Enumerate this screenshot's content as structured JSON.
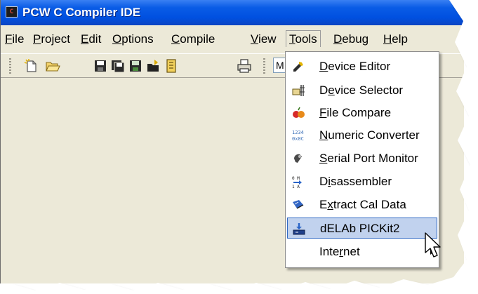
{
  "window": {
    "app_icon_text": "C",
    "title": "PCW C Compiler IDE"
  },
  "menubar": {
    "items": [
      {
        "pre": "",
        "accel": "F",
        "post": "ile"
      },
      {
        "pre": "",
        "accel": "P",
        "post": "roject"
      },
      {
        "pre": "",
        "accel": "E",
        "post": "dit"
      },
      {
        "pre": "",
        "accel": "O",
        "post": "ptions"
      },
      {
        "pre": "",
        "accel": "C",
        "post": "ompile"
      },
      {
        "pre": "",
        "accel": "V",
        "post": "iew"
      },
      {
        "pre": "",
        "accel": "T",
        "post": "ools"
      },
      {
        "pre": "",
        "accel": "D",
        "post": "ebug"
      },
      {
        "pre": "",
        "accel": "H",
        "post": "elp"
      }
    ],
    "active": "Tools"
  },
  "toolbar": {
    "combo_value": "M",
    "icons": [
      "new-file-icon",
      "open-folder-icon",
      "save-icon",
      "save-all-icon",
      "save-as-icon",
      "open-recent-icon",
      "project-icon",
      "print-icon"
    ]
  },
  "tools_menu": {
    "items": [
      {
        "pre": "",
        "accel": "D",
        "post": "evice Editor",
        "icon": "device-editor-icon"
      },
      {
        "pre": "D",
        "accel": "e",
        "post": "vice Selector",
        "icon": "device-selector-icon"
      },
      {
        "pre": "",
        "accel": "F",
        "post": "ile Compare",
        "icon": "file-compare-icon"
      },
      {
        "pre": "",
        "accel": "N",
        "post": "umeric Converter",
        "icon": "numeric-converter-icon"
      },
      {
        "pre": "",
        "accel": "S",
        "post": "erial Port Monitor",
        "icon": "serial-port-monitor-icon"
      },
      {
        "pre": "D",
        "accel": "i",
        "post": "sassembler",
        "icon": "disassembler-icon"
      },
      {
        "pre": "E",
        "accel": "x",
        "post": "tract Cal Data",
        "icon": "extract-cal-data-icon"
      },
      {
        "pre": "dELAb PICKit2",
        "accel": "",
        "post": "",
        "icon": "pickit2-icon"
      },
      {
        "pre": "Inte",
        "accel": "r",
        "post": "net",
        "icon": ""
      }
    ],
    "selected_index": 7
  },
  "colors": {
    "titlebar": "#0A5CE6",
    "menu_face": "#ECE9D8",
    "selection_fill": "#C1D2EE",
    "selection_border": "#316AC5"
  }
}
